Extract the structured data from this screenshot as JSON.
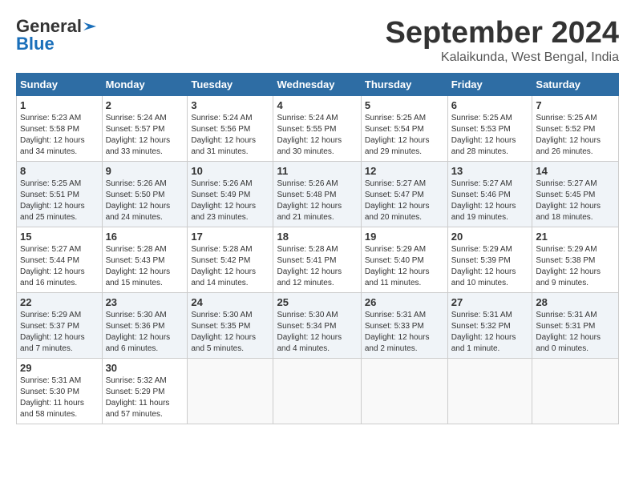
{
  "logo": {
    "line1": "General",
    "line2": "Blue"
  },
  "title": "September 2024",
  "subtitle": "Kalaikunda, West Bengal, India",
  "days_header": [
    "Sunday",
    "Monday",
    "Tuesday",
    "Wednesday",
    "Thursday",
    "Friday",
    "Saturday"
  ],
  "weeks": [
    [
      {
        "day": "1",
        "info": "Sunrise: 5:23 AM\nSunset: 5:58 PM\nDaylight: 12 hours\nand 34 minutes."
      },
      {
        "day": "2",
        "info": "Sunrise: 5:24 AM\nSunset: 5:57 PM\nDaylight: 12 hours\nand 33 minutes."
      },
      {
        "day": "3",
        "info": "Sunrise: 5:24 AM\nSunset: 5:56 PM\nDaylight: 12 hours\nand 31 minutes."
      },
      {
        "day": "4",
        "info": "Sunrise: 5:24 AM\nSunset: 5:55 PM\nDaylight: 12 hours\nand 30 minutes."
      },
      {
        "day": "5",
        "info": "Sunrise: 5:25 AM\nSunset: 5:54 PM\nDaylight: 12 hours\nand 29 minutes."
      },
      {
        "day": "6",
        "info": "Sunrise: 5:25 AM\nSunset: 5:53 PM\nDaylight: 12 hours\nand 28 minutes."
      },
      {
        "day": "7",
        "info": "Sunrise: 5:25 AM\nSunset: 5:52 PM\nDaylight: 12 hours\nand 26 minutes."
      }
    ],
    [
      {
        "day": "8",
        "info": "Sunrise: 5:25 AM\nSunset: 5:51 PM\nDaylight: 12 hours\nand 25 minutes."
      },
      {
        "day": "9",
        "info": "Sunrise: 5:26 AM\nSunset: 5:50 PM\nDaylight: 12 hours\nand 24 minutes."
      },
      {
        "day": "10",
        "info": "Sunrise: 5:26 AM\nSunset: 5:49 PM\nDaylight: 12 hours\nand 23 minutes."
      },
      {
        "day": "11",
        "info": "Sunrise: 5:26 AM\nSunset: 5:48 PM\nDaylight: 12 hours\nand 21 minutes."
      },
      {
        "day": "12",
        "info": "Sunrise: 5:27 AM\nSunset: 5:47 PM\nDaylight: 12 hours\nand 20 minutes."
      },
      {
        "day": "13",
        "info": "Sunrise: 5:27 AM\nSunset: 5:46 PM\nDaylight: 12 hours\nand 19 minutes."
      },
      {
        "day": "14",
        "info": "Sunrise: 5:27 AM\nSunset: 5:45 PM\nDaylight: 12 hours\nand 18 minutes."
      }
    ],
    [
      {
        "day": "15",
        "info": "Sunrise: 5:27 AM\nSunset: 5:44 PM\nDaylight: 12 hours\nand 16 minutes."
      },
      {
        "day": "16",
        "info": "Sunrise: 5:28 AM\nSunset: 5:43 PM\nDaylight: 12 hours\nand 15 minutes."
      },
      {
        "day": "17",
        "info": "Sunrise: 5:28 AM\nSunset: 5:42 PM\nDaylight: 12 hours\nand 14 minutes."
      },
      {
        "day": "18",
        "info": "Sunrise: 5:28 AM\nSunset: 5:41 PM\nDaylight: 12 hours\nand 12 minutes."
      },
      {
        "day": "19",
        "info": "Sunrise: 5:29 AM\nSunset: 5:40 PM\nDaylight: 12 hours\nand 11 minutes."
      },
      {
        "day": "20",
        "info": "Sunrise: 5:29 AM\nSunset: 5:39 PM\nDaylight: 12 hours\nand 10 minutes."
      },
      {
        "day": "21",
        "info": "Sunrise: 5:29 AM\nSunset: 5:38 PM\nDaylight: 12 hours\nand 9 minutes."
      }
    ],
    [
      {
        "day": "22",
        "info": "Sunrise: 5:29 AM\nSunset: 5:37 PM\nDaylight: 12 hours\nand 7 minutes."
      },
      {
        "day": "23",
        "info": "Sunrise: 5:30 AM\nSunset: 5:36 PM\nDaylight: 12 hours\nand 6 minutes."
      },
      {
        "day": "24",
        "info": "Sunrise: 5:30 AM\nSunset: 5:35 PM\nDaylight: 12 hours\nand 5 minutes."
      },
      {
        "day": "25",
        "info": "Sunrise: 5:30 AM\nSunset: 5:34 PM\nDaylight: 12 hours\nand 4 minutes."
      },
      {
        "day": "26",
        "info": "Sunrise: 5:31 AM\nSunset: 5:33 PM\nDaylight: 12 hours\nand 2 minutes."
      },
      {
        "day": "27",
        "info": "Sunrise: 5:31 AM\nSunset: 5:32 PM\nDaylight: 12 hours\nand 1 minute."
      },
      {
        "day": "28",
        "info": "Sunrise: 5:31 AM\nSunset: 5:31 PM\nDaylight: 12 hours\nand 0 minutes."
      }
    ],
    [
      {
        "day": "29",
        "info": "Sunrise: 5:31 AM\nSunset: 5:30 PM\nDaylight: 11 hours\nand 58 minutes."
      },
      {
        "day": "30",
        "info": "Sunrise: 5:32 AM\nSunset: 5:29 PM\nDaylight: 11 hours\nand 57 minutes."
      },
      {
        "day": "",
        "info": ""
      },
      {
        "day": "",
        "info": ""
      },
      {
        "day": "",
        "info": ""
      },
      {
        "day": "",
        "info": ""
      },
      {
        "day": "",
        "info": ""
      }
    ]
  ]
}
